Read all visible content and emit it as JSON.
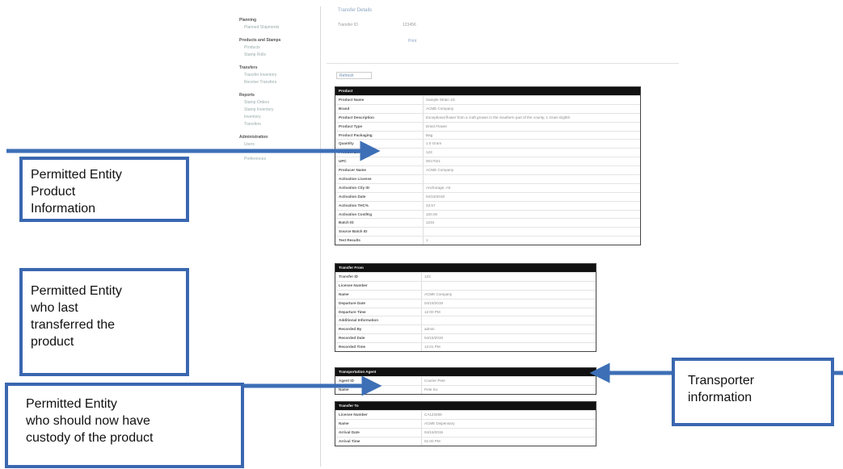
{
  "colors": {
    "callout_border": "#3a67b0",
    "arrow": "#3d6fb6",
    "table_header": "#111111"
  },
  "sidebar": {
    "sections": [
      {
        "title": "Planning",
        "items": [
          "Planned Shipments"
        ]
      },
      {
        "title": "Products and Stamps",
        "items": [
          "Products",
          "Stamp Rolls"
        ]
      },
      {
        "title": "Transfers",
        "items": [
          "Transfer Inventory",
          "Receive Transfers"
        ]
      },
      {
        "title": "Reports",
        "items": [
          "Stamp Orders",
          "Stamp Inventory",
          "Inventory",
          "Transfers"
        ]
      },
      {
        "title": "Administration",
        "items": [
          "Users",
          "Roles",
          "Preferences"
        ]
      }
    ]
  },
  "top": {
    "title": "Transfer Details",
    "row_label": "Transfer ID",
    "row_value": "123456",
    "link": "Print",
    "control_label": "Refresh"
  },
  "product_table": {
    "header": "Product",
    "rows": [
      {
        "k": "Product Name",
        "v": "Sample Strain 1G"
      },
      {
        "k": "Brand",
        "v": "ACME Company"
      },
      {
        "k": "Product Description",
        "v": "Exceptional flower from a craft grower in the Southern part of the county, 1 Gram Eighth"
      },
      {
        "k": "Product Type",
        "v": "Dried Flower"
      },
      {
        "k": "Product Packaging",
        "v": "Bag"
      },
      {
        "k": "Quantity",
        "v": "1.0 Gram"
      },
      {
        "k": "Product Lot",
        "v": "123"
      },
      {
        "k": "UPC",
        "v": "0017021"
      },
      {
        "k": "Producer Name",
        "v": "ACME Company"
      },
      {
        "k": "Activation License",
        "v": ""
      },
      {
        "k": "Activation City ID",
        "v": "Anchorage, AK"
      },
      {
        "k": "Activation Date",
        "v": "04/15/2019"
      },
      {
        "k": "Activation THC%",
        "v": "23.57"
      },
      {
        "k": "Activation Cost/Kg",
        "v": "100.00"
      },
      {
        "k": "Batch ID",
        "v": "1234"
      },
      {
        "k": "Source Batch ID",
        "v": ""
      },
      {
        "k": "Test Results",
        "v": "1"
      }
    ]
  },
  "from_table": {
    "header": "Transfer From",
    "rows": [
      {
        "k": "Transfer ID",
        "v": "123"
      },
      {
        "k": "License Number",
        "v": ""
      },
      {
        "k": "Name",
        "v": "ACME Company"
      },
      {
        "k": "Departure Date",
        "v": "04/15/2019"
      },
      {
        "k": "Departure Time",
        "v": "12:00 PM"
      },
      {
        "k": "Additional Information",
        "v": ""
      },
      {
        "k": "Recorded By",
        "v": "admin"
      },
      {
        "k": "Recorded Date",
        "v": "04/15/2019"
      },
      {
        "k": "Recorded Time",
        "v": "12:01 PM"
      }
    ]
  },
  "transport_table": {
    "header": "Transportation Agent",
    "rows": [
      {
        "k": "Agent ID",
        "v": "Courier Pete"
      },
      {
        "k": "Name",
        "v": "Pete Inc"
      }
    ]
  },
  "to_table": {
    "header": "Transfer To",
    "rows": [
      {
        "k": "License Number",
        "v": "CA123456"
      },
      {
        "k": "Name",
        "v": "ACME Dispensary"
      },
      {
        "k": "Arrival Date",
        "v": "04/15/2019"
      },
      {
        "k": "Arrival Time",
        "v": "01:00 PM"
      }
    ]
  },
  "callouts": {
    "product_info": [
      "Permitted Entity",
      "Product",
      "Information"
    ],
    "last_transferred": [
      "Permitted Entity",
      "who last",
      "transferred the",
      "product"
    ],
    "custody": [
      "Permitted Entity",
      "who should now have",
      "custody of the product"
    ],
    "transporter": [
      "Transporter",
      "information"
    ]
  }
}
